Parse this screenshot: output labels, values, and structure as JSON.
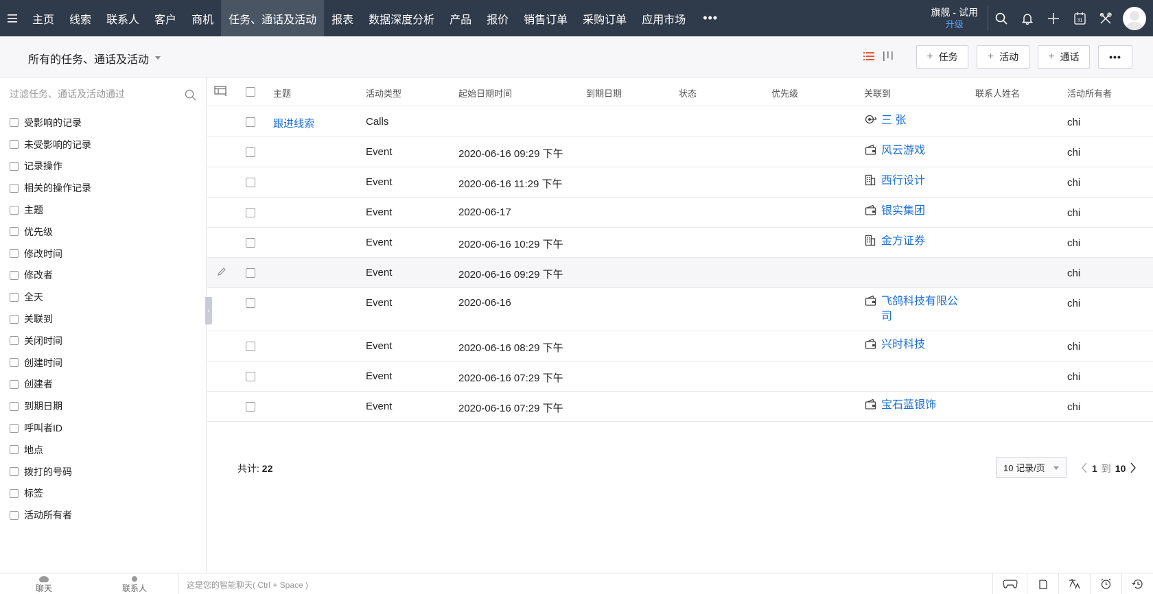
{
  "nav": {
    "items": [
      "主页",
      "线索",
      "联系人",
      "客户",
      "商机",
      "任务、通话及活动",
      "报表",
      "数据深度分析",
      "产品",
      "报价",
      "销售订单",
      "采购订单",
      "应用市场"
    ],
    "active_index": 5,
    "more": "•••",
    "plan": "旗舰 - 试用",
    "upgrade": "升级"
  },
  "toolbar": {
    "view_title": "所有的任务、通话及活动",
    "task_label": "任务",
    "event_label": "活动",
    "call_label": "通话",
    "more": "•••"
  },
  "sidebar": {
    "search_placeholder": "过滤任务、通话及活动通过",
    "filters": [
      "受影响的记录",
      "未受影响的记录",
      "记录操作",
      "相关的操作记录",
      "主题",
      "优先级",
      "修改时间",
      "修改者",
      "全天",
      "关联到",
      "关闭时间",
      "创建时间",
      "创建者",
      "到期日期",
      "呼叫者ID",
      "地点",
      "拨打的号码",
      "标签",
      "活动所有者"
    ]
  },
  "table": {
    "headers": {
      "subject": "主题",
      "type": "活动类型",
      "start": "起始日期时间",
      "due": "到期日期",
      "status": "状态",
      "priority": "优先级",
      "related": "关联到",
      "contact": "联系人姓名",
      "owner": "活动所有者"
    },
    "rows": [
      {
        "subject": "跟进线索",
        "type": "Calls",
        "start": "",
        "related": "三 张",
        "related_icon": "lead-icon",
        "owner": "chi"
      },
      {
        "subject": "",
        "type": "Event",
        "start": "2020-06-16 09:29 下午",
        "related": "风云游戏",
        "related_icon": "deal-icon",
        "owner": "chi"
      },
      {
        "subject": "",
        "type": "Event",
        "start": "2020-06-16 11:29 下午",
        "related": "西行设计",
        "related_icon": "account-icon",
        "owner": "chi"
      },
      {
        "subject": "",
        "type": "Event",
        "start": "2020-06-17",
        "related": "银实集团",
        "related_icon": "deal-icon",
        "owner": "chi"
      },
      {
        "subject": "",
        "type": "Event",
        "start": "2020-06-16 10:29 下午",
        "related": "金方证券",
        "related_icon": "account-icon",
        "owner": "chi"
      },
      {
        "subject": "",
        "type": "Event",
        "start": "2020-06-16 09:29 下午",
        "related": "",
        "related_icon": "",
        "owner": "chi"
      },
      {
        "subject": "",
        "type": "Event",
        "start": "2020-06-16",
        "related": "飞鸽科技有限公司",
        "related_icon": "deal-icon",
        "owner": "chi"
      },
      {
        "subject": "",
        "type": "Event",
        "start": "2020-06-16 08:29 下午",
        "related": "兴时科技",
        "related_icon": "deal-icon",
        "owner": "chi"
      },
      {
        "subject": "",
        "type": "Event",
        "start": "2020-06-16 07:29 下午",
        "related": "",
        "related_icon": "",
        "owner": "chi"
      },
      {
        "subject": "",
        "type": "Event",
        "start": "2020-06-16 07:29 下午",
        "related": "宝石蓝银饰",
        "related_icon": "deal-icon",
        "owner": "chi"
      }
    ],
    "total_label": "共计:",
    "total_count": "22",
    "per_page": "10 记录/页",
    "page_from": "1",
    "page_to_label": "到",
    "page_to": "10"
  },
  "bottombar": {
    "chat_label": "聊天",
    "contacts_label": "联系人",
    "chat_placeholder": "这是您的智能聊天( Ctrl + Space )"
  }
}
